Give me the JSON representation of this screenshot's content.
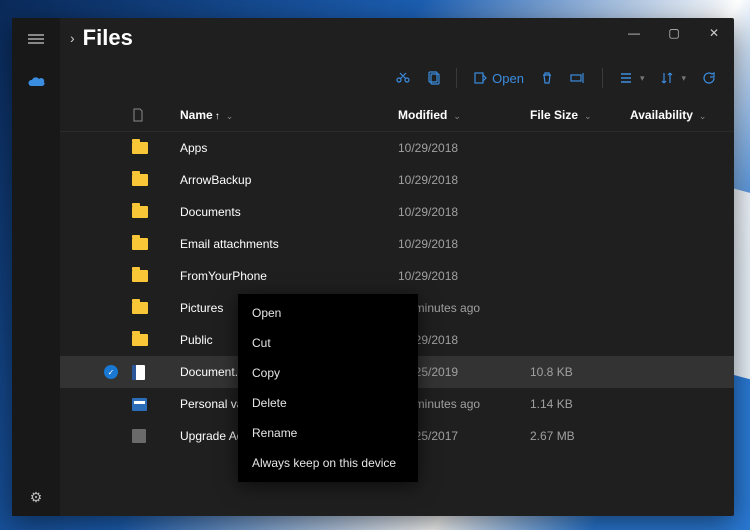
{
  "header": {
    "location": "Files"
  },
  "toolbar": {
    "open_label": "Open"
  },
  "columns": {
    "name": "Name",
    "modified": "Modified",
    "size": "File Size",
    "availability": "Availability"
  },
  "sort": {
    "column": "name",
    "direction": "asc"
  },
  "selected_index": 7,
  "files": [
    {
      "icon": "folder",
      "name": "Apps",
      "modified": "10/29/2018",
      "size": "",
      "availability": ""
    },
    {
      "icon": "folder",
      "name": "ArrowBackup",
      "modified": "10/29/2018",
      "size": "",
      "availability": ""
    },
    {
      "icon": "folder",
      "name": "Documents",
      "modified": "10/29/2018",
      "size": "",
      "availability": ""
    },
    {
      "icon": "folder",
      "name": "Email attachments",
      "modified": "10/29/2018",
      "size": "",
      "availability": ""
    },
    {
      "icon": "folder",
      "name": "FromYourPhone",
      "modified": "10/29/2018",
      "size": "",
      "availability": ""
    },
    {
      "icon": "folder",
      "name": "Pictures",
      "modified": "14 minutes ago",
      "size": "",
      "availability": ""
    },
    {
      "icon": "folder",
      "name": "Public",
      "modified": "10/29/2018",
      "size": "",
      "availability": ""
    },
    {
      "icon": "word",
      "name": "Document.docx",
      "modified": "12/25/2019",
      "size": "10.8 KB",
      "availability": ""
    },
    {
      "icon": "link",
      "name": "Personal vault.lnk",
      "modified": "14 minutes ago",
      "size": "1.14 KB",
      "availability": ""
    },
    {
      "icon": "appx",
      "name": "Upgrade Advisor.appx",
      "modified": "10/25/2017",
      "size": "2.67 MB",
      "availability": ""
    }
  ],
  "context_menu": {
    "items": [
      "Open",
      "Cut",
      "Copy",
      "Delete",
      "Rename",
      "Always keep on this device"
    ]
  }
}
